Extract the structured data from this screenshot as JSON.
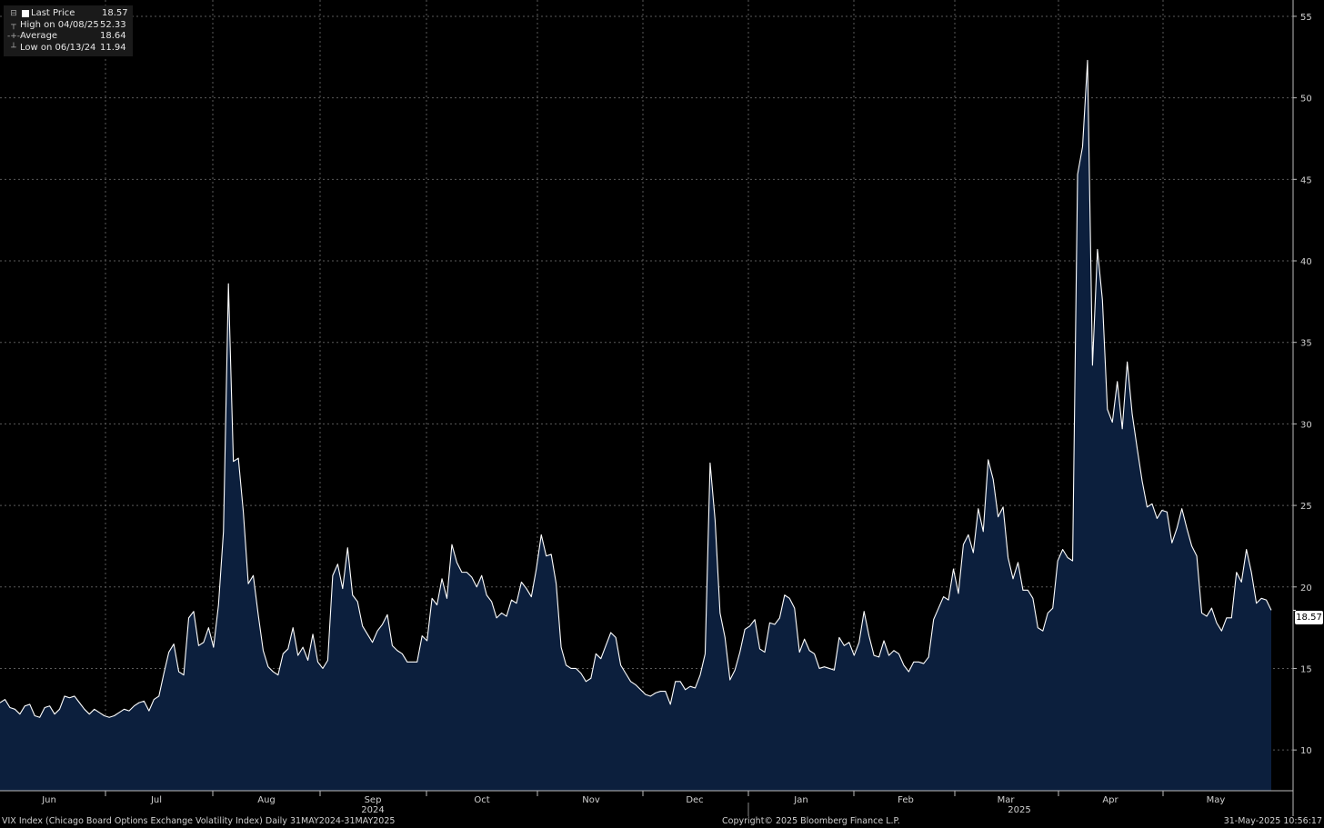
{
  "legend": {
    "rows": [
      {
        "label": "Last Price",
        "value": "18.57",
        "icon": "square-swatch-icon"
      },
      {
        "label": "High on 04/08/25",
        "value": "52.33",
        "icon": "high-marker-icon"
      },
      {
        "label": "Average",
        "value": "18.64",
        "icon": "average-marker-icon"
      },
      {
        "label": "Low on 06/13/24",
        "value": "11.94",
        "icon": "low-marker-icon"
      }
    ]
  },
  "last_price_badge": "18.57",
  "footer": {
    "left": "VIX Index (Chicago Board Options Exchange Volatility Index)  Daily 31MAY2024-31MAY2025",
    "center": "Copyright© 2025 Bloomberg Finance L.P.",
    "right": "31-May-2025 10:56:17"
  },
  "colors": {
    "background": "#000000",
    "area_fill": "#0c1f3d",
    "line": "#ffffff",
    "grid": "#5a5a5a"
  },
  "chart_data": {
    "type": "area",
    "title": "",
    "xlabel": "",
    "ylabel": "",
    "ylim": [
      7.5,
      56
    ],
    "y_ticks": [
      10,
      15,
      20,
      25,
      30,
      35,
      40,
      45,
      50,
      55
    ],
    "x_tick_labels": [
      "Jun",
      "Jul",
      "Aug",
      "Sep",
      "Oct",
      "Nov",
      "Dec",
      "Jan",
      "Feb",
      "Mar",
      "Apr",
      "May"
    ],
    "year_labels": [
      {
        "label": "2024",
        "month": "Sep"
      },
      {
        "label": "2025",
        "month": "Mar"
      }
    ],
    "grid": true,
    "series": [
      {
        "name": "Last Price",
        "values": [
          12.9,
          13.1,
          12.6,
          12.5,
          12.2,
          12.7,
          12.8,
          12.1,
          12.0,
          12.6,
          12.7,
          12.2,
          12.5,
          13.3,
          13.2,
          13.3,
          12.9,
          12.5,
          12.2,
          12.5,
          12.3,
          12.1,
          12.0,
          12.1,
          12.3,
          12.5,
          12.4,
          12.7,
          12.9,
          13.0,
          12.4,
          13.1,
          13.3,
          14.7,
          16.0,
          16.5,
          14.8,
          14.6,
          18.1,
          18.5,
          16.4,
          16.6,
          17.5,
          16.3,
          18.9,
          23.4,
          38.6,
          27.7,
          27.9,
          24.6,
          20.2,
          20.7,
          18.3,
          16.1,
          15.1,
          14.8,
          14.6,
          15.9,
          16.2,
          17.5,
          15.8,
          16.3,
          15.5,
          17.1,
          15.4,
          15.0,
          15.5,
          20.7,
          21.4,
          19.9,
          22.4,
          19.5,
          19.1,
          17.6,
          17.1,
          16.6,
          17.3,
          17.7,
          18.3,
          16.4,
          16.1,
          15.9,
          15.4,
          15.4,
          15.4,
          17.0,
          16.7,
          19.3,
          18.9,
          20.5,
          19.3,
          22.6,
          21.5,
          20.9,
          20.9,
          20.6,
          20.0,
          20.7,
          19.5,
          19.1,
          18.1,
          18.4,
          18.2,
          19.2,
          19.0,
          20.3,
          19.9,
          19.4,
          21.1,
          23.2,
          21.9,
          22.0,
          20.2,
          16.3,
          15.2,
          15.0,
          15.0,
          14.7,
          14.2,
          14.4,
          15.9,
          15.6,
          16.4,
          17.2,
          16.9,
          15.2,
          14.7,
          14.2,
          14.0,
          13.7,
          13.4,
          13.3,
          13.5,
          13.6,
          13.6,
          12.8,
          14.2,
          14.2,
          13.7,
          13.9,
          13.8,
          14.6,
          15.9,
          27.6,
          24.1,
          18.4,
          16.9,
          14.3,
          14.9,
          16.0,
          17.4,
          17.6,
          18.0,
          16.2,
          16.0,
          17.8,
          17.7,
          18.1,
          19.5,
          19.3,
          18.7,
          16.0,
          16.8,
          16.1,
          15.9,
          15.0,
          15.1,
          15.0,
          14.9,
          16.9,
          16.4,
          16.6,
          15.8,
          16.6,
          18.5,
          17.0,
          15.8,
          15.7,
          16.7,
          15.8,
          16.1,
          15.9,
          15.2,
          14.8,
          15.4,
          15.4,
          15.3,
          15.7,
          18.0,
          18.7,
          19.4,
          19.2,
          21.1,
          19.6,
          22.6,
          23.2,
          22.1,
          24.8,
          23.4,
          27.8,
          26.6,
          24.3,
          24.9,
          21.8,
          20.5,
          21.5,
          19.8,
          19.8,
          19.3,
          17.5,
          17.3,
          18.4,
          18.7,
          21.6,
          22.3,
          21.8,
          21.6,
          45.3,
          47.0,
          52.3,
          33.6,
          40.7,
          37.6,
          30.9,
          30.1,
          32.6,
          29.7,
          33.8,
          30.6,
          28.5,
          26.5,
          24.9,
          25.1,
          24.2,
          24.7,
          24.6,
          22.7,
          23.6,
          24.8,
          23.6,
          22.5,
          21.9,
          18.4,
          18.2,
          18.7,
          17.8,
          17.3,
          18.1,
          18.1,
          20.9,
          20.3,
          22.3,
          20.9,
          19.0,
          19.3,
          19.2,
          18.57
        ]
      }
    ],
    "average": 18.64,
    "high": {
      "date": "04/08/25",
      "value": 52.33
    },
    "low": {
      "date": "06/13/24",
      "value": 11.94
    },
    "last": 18.57
  }
}
